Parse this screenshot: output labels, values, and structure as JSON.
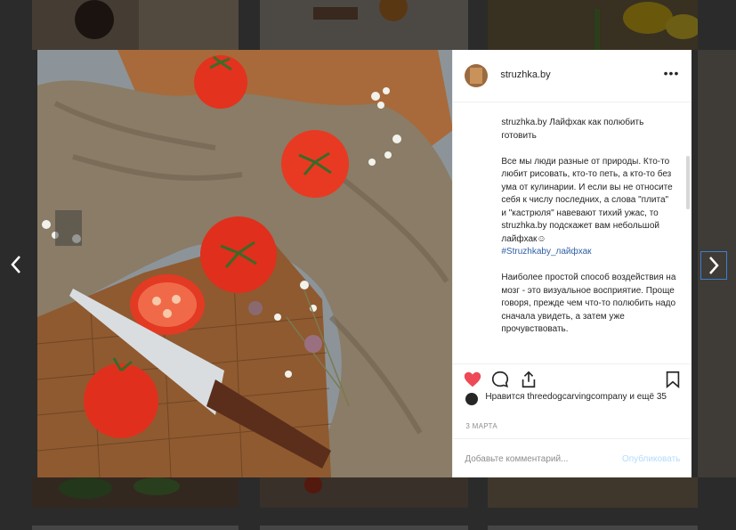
{
  "post": {
    "username": "struzhka.by",
    "more_label": "•••",
    "caption": {
      "header_user": "struzhka.by",
      "header_text": " Лайфхак как полюбить готовить",
      "para1": "Все мы люди разные от природы. Кто-то любит рисовать, кто-то петь, а кто-то без ума от кулинарии. И если вы не относите себя к числу последних, а слова \"плита\" и \"кастрюля\" навевают тихий ужас, то struzhka.by подскажет вам небольшой лайфхак☺",
      "hashtag": "#Struzhkaby_лайфхак",
      "para2": "Наиболее простой способ воздействия на мозг - это визуальное восприятие. Проще говоря, прежде чем что-то полюбить надо сначала увидеть, а затем уже прочувствовать."
    },
    "likes": {
      "prefix": "Нравится ",
      "user": "threedogcarvingcompany",
      "suffix": " и ещё 35"
    },
    "date": "3 МАРТА",
    "comment_placeholder": "Добавьте комментарий...",
    "post_label": "Опубликовать"
  },
  "icons": {
    "like": "heart-icon",
    "comment": "comment-icon",
    "share": "share-icon",
    "save": "bookmark-icon",
    "prev": "chevron-left-icon",
    "next": "chevron-right-icon"
  },
  "colors": {
    "heart": "#ed4956",
    "hashtag": "#2f5fa5",
    "post_button": "#b3dbff",
    "overlay": "#000000"
  }
}
